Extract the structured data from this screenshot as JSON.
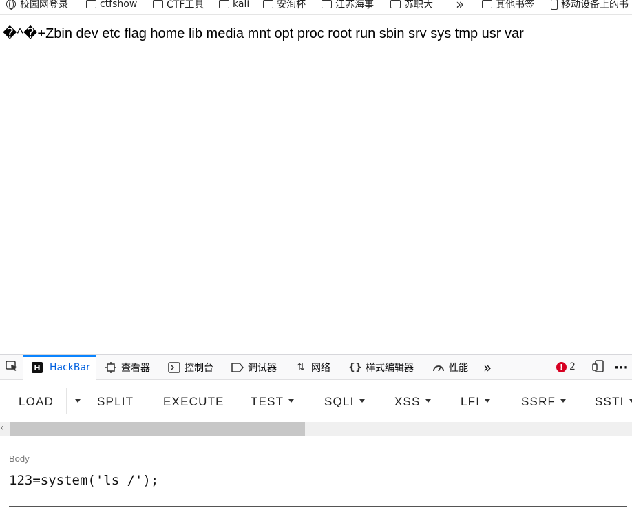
{
  "bookmarks": [
    {
      "label": "校园网登录",
      "icon": "globe-icon"
    },
    {
      "label": "ctfshow",
      "icon": "folder-icon"
    },
    {
      "label": "CTF工具",
      "icon": "folder-icon"
    },
    {
      "label": "kali",
      "icon": "folder-icon"
    },
    {
      "label": "安洵杯",
      "icon": "folder-icon"
    },
    {
      "label": "江苏海事",
      "icon": "folder-icon"
    },
    {
      "label": "苏职大",
      "icon": "folder-icon"
    },
    {
      "label": "其他书签",
      "icon": "folder-icon"
    },
    {
      "label": "移动设备上的书",
      "icon": "phone-icon"
    }
  ],
  "page": {
    "output": "�^�+Zbin dev etc flag home lib media mnt opt proc root run sbin srv sys tmp usr var"
  },
  "devtools": {
    "tabs": [
      {
        "label": "HackBar",
        "icon": "hackbar-icon",
        "active": true
      },
      {
        "label": "查看器",
        "icon": "inspector-icon"
      },
      {
        "label": "控制台",
        "icon": "console-icon"
      },
      {
        "label": "调试器",
        "icon": "debugger-icon"
      },
      {
        "label": "网络",
        "icon": "network-icon"
      },
      {
        "label": "样式编辑器",
        "icon": "style-editor-icon"
      },
      {
        "label": "性能",
        "icon": "performance-icon"
      }
    ],
    "error_count": "2"
  },
  "hackbar": {
    "buttons": {
      "load": "LOAD",
      "split": "SPLIT",
      "execute": "EXECUTE",
      "test": "TEST",
      "sqli": "SQLI",
      "xss": "XSS",
      "lfi": "LFI",
      "ssrf": "SSRF",
      "ssti": "SSTI"
    },
    "body_label": "Body",
    "body_value": "123=system('ls /');"
  },
  "colors": {
    "accent": "#0a84ff",
    "active_tab_text": "#0060df",
    "error": "#d70022"
  }
}
